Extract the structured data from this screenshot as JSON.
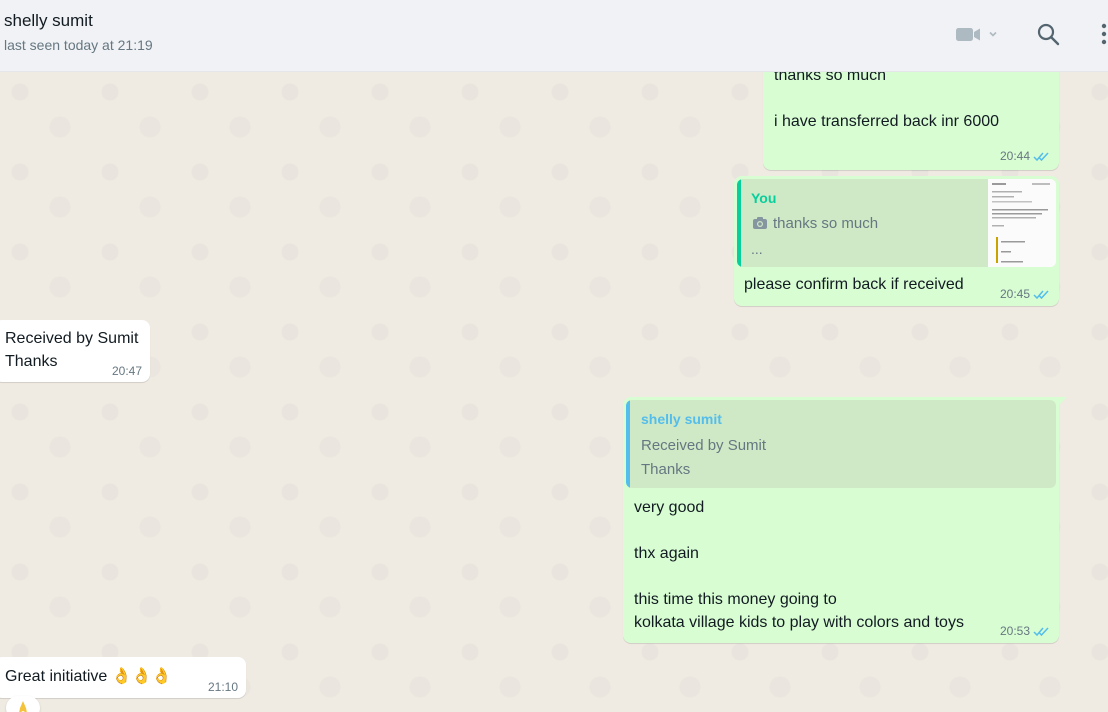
{
  "header": {
    "contact_name": "shelly sumit",
    "last_seen": "last seen today at 21:19",
    "icons": [
      "video-call-icon",
      "chevron-down-icon",
      "search-icon",
      "menu-icon"
    ]
  },
  "colors": {
    "outgoing_bubble": "#d9fdd3",
    "incoming_bubble": "#ffffff",
    "read_ticks": "#53bdeb",
    "quote_you": "#06cf9c",
    "quote_contact": "#53bdeb",
    "chat_background": "#efeae2"
  },
  "messages": [
    {
      "direction": "outgoing",
      "text": "thanks so much\n\ni have transferred back inr 6000",
      "time": "20:44",
      "status": "read"
    },
    {
      "direction": "outgoing",
      "quote": {
        "author": "You",
        "text": "thanks so much",
        "ellipsis": "...",
        "has_photo": true
      },
      "text": "please confirm back if received",
      "time": "20:45",
      "status": "read"
    },
    {
      "direction": "incoming",
      "text": "Received by Sumit\nThanks",
      "time": "20:47"
    },
    {
      "direction": "outgoing",
      "quote": {
        "author": "shelly sumit",
        "text": "Received by Sumit\nThanks"
      },
      "text": "very good\n\nthx again\n\nthis time this money going to\nkolkata village kids to play with colors and toys",
      "time": "20:53",
      "status": "read"
    },
    {
      "direction": "incoming",
      "text": "Great initiative 👌👌👌",
      "time": "21:10"
    }
  ]
}
